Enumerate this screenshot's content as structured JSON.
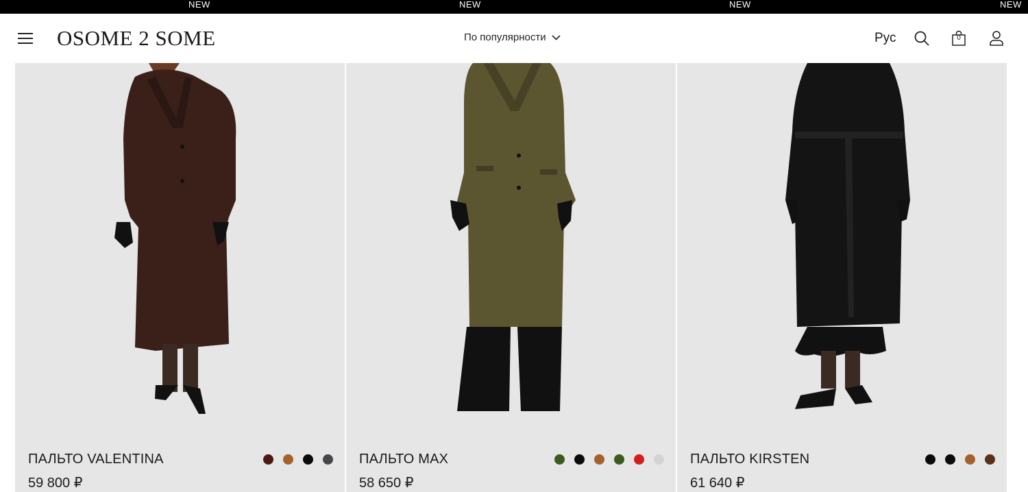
{
  "ticker": {
    "items": [
      "NEW",
      "NEW",
      "NEW",
      "NEW"
    ]
  },
  "header": {
    "logo": "OSOME 2 SOME",
    "sort_label": "По популярности",
    "language": "Рус",
    "cart_count": "0",
    "icons": [
      "menu-icon",
      "search-icon",
      "bag-icon",
      "user-icon",
      "chevron-down-icon"
    ]
  },
  "products": [
    {
      "name": "ПАЛЬТО VALENTINA",
      "price": "59 800 ₽",
      "coat_color": "#3a2019",
      "swatches": [
        "#4a1a12",
        "#a5602c",
        "#0b0b0b",
        "#45474a"
      ]
    },
    {
      "name": "ПАЛЬТО MAX",
      "price": "58 650 ₽",
      "coat_color": "#5b5530",
      "swatches": [
        "#3b5a21",
        "#0b0b0b",
        "#a5602c",
        "#3b5a21",
        "#d41d1d",
        "#d3d3d3"
      ]
    },
    {
      "name": "ПАЛЬТО KIRSTEN",
      "price": "61 640 ₽",
      "coat_color": "#141414",
      "swatches": [
        "#0b0b0b",
        "#0b0b0b",
        "#a5602c",
        "#5a3018"
      ]
    }
  ]
}
